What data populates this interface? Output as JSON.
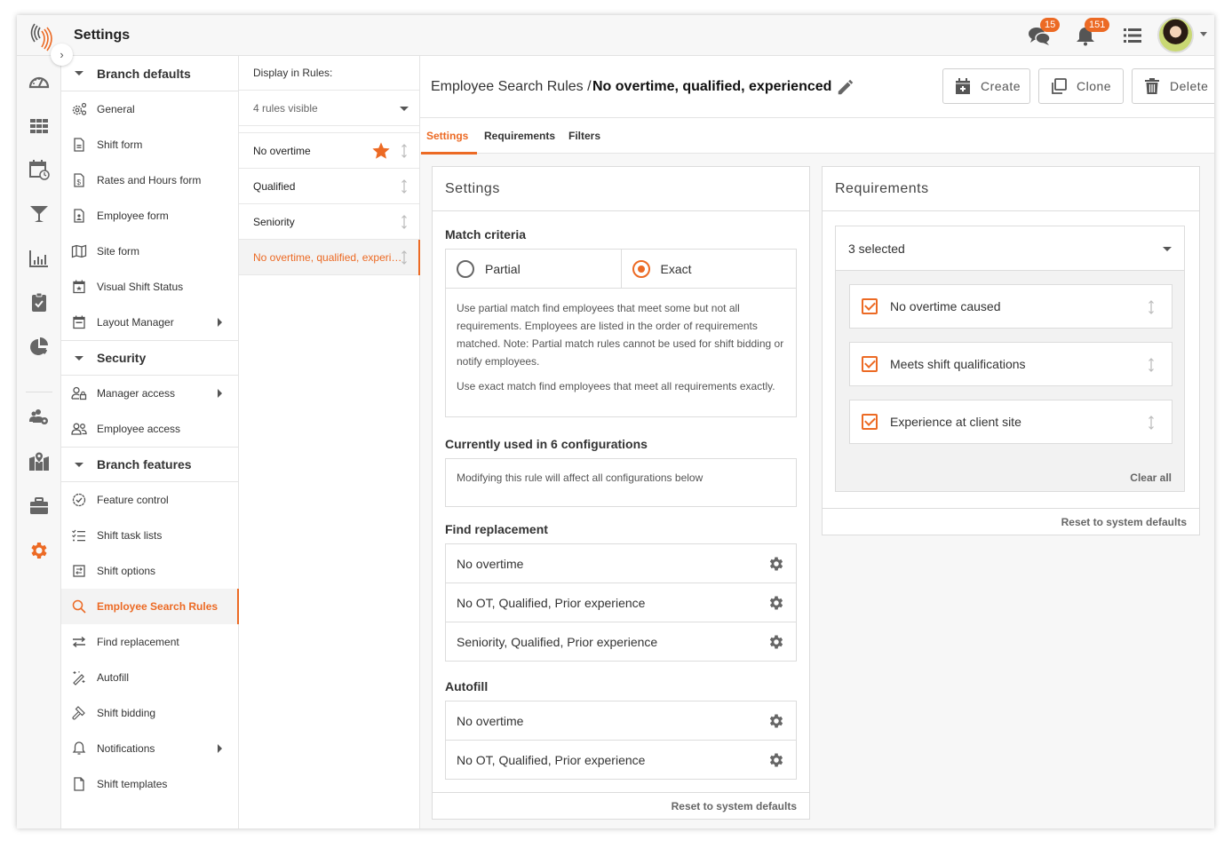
{
  "app": {
    "title": "Settings",
    "notifications": {
      "messages_count": "15",
      "alerts_count": "151"
    },
    "accent_color": "#ec6a24"
  },
  "rail": {
    "icons": [
      "dashboard-icon",
      "grid-icon",
      "calendar-clock-icon",
      "filter-icon",
      "bar-chart-icon",
      "clipboard-check-icon",
      "pie-chart-icon",
      "users-gear-icon",
      "map-pin-icon",
      "briefcase-icon",
      "gear-icon"
    ],
    "active": "gear-icon"
  },
  "nav": {
    "groups": [
      {
        "label": "Branch defaults",
        "items": [
          {
            "label": "General",
            "icon": "gears-icon"
          },
          {
            "label": "Shift form",
            "icon": "document-icon"
          },
          {
            "label": "Rates and Hours form",
            "icon": "dollar-document-icon"
          },
          {
            "label": "Employee form",
            "icon": "person-document-icon"
          },
          {
            "label": "Site form",
            "icon": "map-icon"
          },
          {
            "label": "Visual Shift Status",
            "icon": "calendar-star-icon"
          },
          {
            "label": "Layout Manager",
            "icon": "calendar-icon",
            "has_submenu": true
          }
        ]
      },
      {
        "label": "Security",
        "items": [
          {
            "label": "Manager access",
            "icon": "user-lock-icon",
            "has_submenu": true
          },
          {
            "label": "Employee access",
            "icon": "users-icon"
          }
        ]
      },
      {
        "label": "Branch features",
        "items": [
          {
            "label": "Feature control",
            "icon": "check-badge-icon"
          },
          {
            "label": "Shift task lists",
            "icon": "checklist-icon"
          },
          {
            "label": "Shift options",
            "icon": "options-icon"
          },
          {
            "label": "Employee Search Rules",
            "icon": "search-icon",
            "active": true
          },
          {
            "label": "Find replacement",
            "icon": "swap-icon"
          },
          {
            "label": "Autofill",
            "icon": "magic-wand-icon"
          },
          {
            "label": "Shift bidding",
            "icon": "gavel-icon"
          },
          {
            "label": "Notifications",
            "icon": "bell-icon",
            "has_submenu": true
          },
          {
            "label": "Shift templates",
            "icon": "file-icon"
          }
        ]
      }
    ]
  },
  "rules": {
    "display_label": "Display in Rules:",
    "visible_select": "4 rules visible",
    "items": [
      {
        "label": "No overtime",
        "starred": true
      },
      {
        "label": "Qualified"
      },
      {
        "label": "Seniority"
      },
      {
        "label": "No overtime, qualified, experienced",
        "active": true
      }
    ]
  },
  "main": {
    "breadcrumb": "Employee Search Rules /",
    "current_rule": "No overtime, qualified, experienced",
    "buttons": {
      "create": "Create",
      "clone": "Clone",
      "delete": "Delete"
    },
    "tabs": [
      {
        "label": "Settings",
        "active": true
      },
      {
        "label": "Requirements"
      },
      {
        "label": "Filters"
      }
    ],
    "settings_card": {
      "title": "Settings",
      "match_criteria": {
        "title": "Match criteria",
        "options": [
          {
            "label": "Partial",
            "selected": false
          },
          {
            "label": "Exact",
            "selected": true
          }
        ],
        "description_1": "Use partial match find employees that meet some but not all requirements. Employees are listed in the order of requirements matched. Note: Partial match rules cannot be used for shift bidding or notify employees.",
        "description_2": "Use exact match find employees that meet all requirements exactly."
      },
      "usage": {
        "title": "Currently used in 6 configurations",
        "note": "Modifying this rule will affect all configurations below"
      },
      "find_replacement": {
        "title": "Find replacement",
        "items": [
          "No overtime",
          "No OT, Qualified, Prior experience",
          "Seniority, Qualified, Prior experience"
        ]
      },
      "autofill": {
        "title": "Autofill",
        "items": [
          "No overtime",
          "No OT, Qualified, Prior experience"
        ]
      },
      "reset_label": "Reset to system defaults"
    },
    "requirements_card": {
      "title": "Requirements",
      "select_value": "3 selected",
      "items": [
        {
          "label": "No overtime caused",
          "checked": true
        },
        {
          "label": "Meets shift qualifications",
          "checked": true
        },
        {
          "label": "Experience at client site",
          "checked": true
        }
      ],
      "clear_all": "Clear all",
      "reset_label": "Reset to system defaults"
    }
  }
}
